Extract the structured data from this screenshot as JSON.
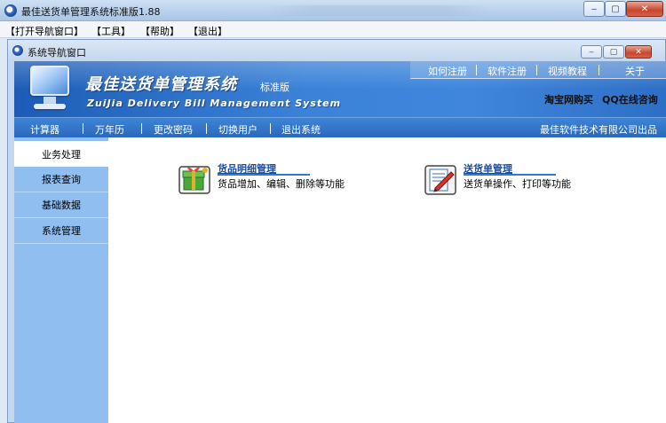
{
  "window": {
    "title": "最佳送货单管理系统标准版1.88",
    "minimize": "‒",
    "maximize": "▢",
    "close": "✕"
  },
  "menu": [
    "【打开导航窗口】",
    "【工具】",
    "【帮助】",
    "【退出】"
  ],
  "nav_window": {
    "title": "系统导航窗口",
    "minimize": "‒",
    "maximize": "▢",
    "close": "✕"
  },
  "banner": {
    "app_name": "最佳送货单管理系统",
    "edition": "标准版",
    "subtitle": "ZuiJia Delivery Bill Management System",
    "top_links": [
      "如何注册",
      "软件注册",
      "视频教程",
      "关于"
    ],
    "buy_link": "淘宝网购买",
    "qq_link": "QQ在线咨询"
  },
  "toolbar": {
    "items": [
      "计算器",
      "万年历",
      "更改密码",
      "切换用户",
      "退出系统"
    ],
    "company": "最佳软件技术有限公司出品"
  },
  "sidebar": {
    "items": [
      "业务处理",
      "报表查询",
      "基础数据",
      "系统管理"
    ],
    "active": "业务处理"
  },
  "modules": [
    {
      "title": "货品明细管理",
      "description": "货品增加、编辑、删除等功能",
      "icon": "gift-box-icon"
    },
    {
      "title": "送货单管理",
      "description": "送货单操作、打印等功能",
      "icon": "document-pen-icon"
    }
  ],
  "colors": {
    "banner_blue": "#3b82d8",
    "toolbar_blue": "#2a69bd",
    "sidebar_blue": "#91bef0",
    "link_blue": "#1b4fa3"
  }
}
